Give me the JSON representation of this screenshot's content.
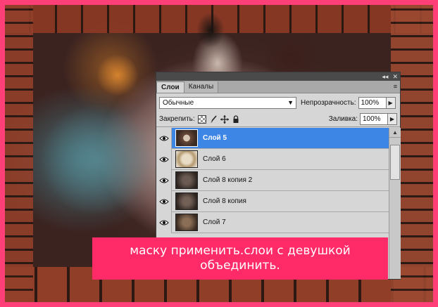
{
  "panel": {
    "strip_controls": [
      "◂◂",
      "✕"
    ],
    "tabs": [
      {
        "label": "Слои",
        "active": true
      },
      {
        "label": "Каналы",
        "active": false
      }
    ],
    "menu_icon": "≡",
    "blend_mode": "Обычные",
    "opacity_label": "Непрозрачность:",
    "opacity_value": "100%",
    "lock_label": "Закрепить:",
    "lock_icons": [
      "lock-transparent-icon",
      "brush-icon",
      "move-icon",
      "lock-icon"
    ],
    "fill_label": "Заливка:",
    "fill_value": "100%",
    "layers": [
      {
        "name": "Слой 5",
        "selected": true,
        "visible": true
      },
      {
        "name": "Слой 6",
        "selected": false,
        "visible": true
      },
      {
        "name": "Слой 8 копия 2",
        "selected": false,
        "visible": true
      },
      {
        "name": "Слой 8 копия",
        "selected": false,
        "visible": true
      },
      {
        "name": "Слой 7",
        "selected": false,
        "visible": true
      }
    ]
  },
  "caption": {
    "text": "маску применить.слои с девушкой объединить."
  },
  "colors": {
    "frame": "#ff3f78",
    "caption_bg": "#ff2a68",
    "selected_layer": "#3d86e6"
  }
}
